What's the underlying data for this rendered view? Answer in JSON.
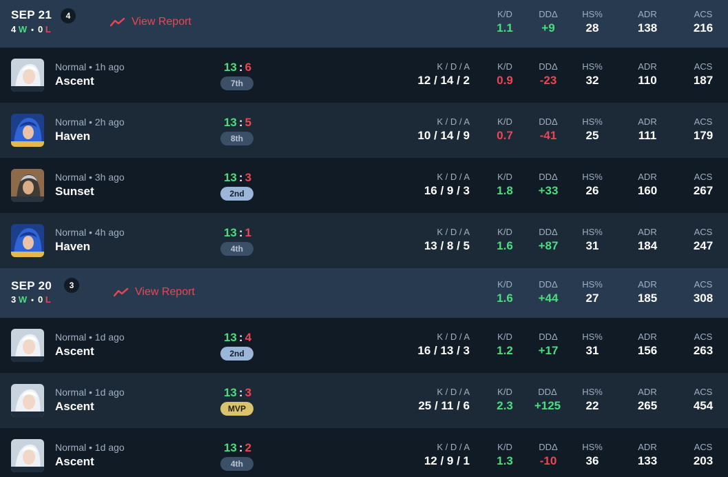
{
  "days": [
    {
      "date": "SEP 21",
      "count": "4",
      "wins": "4",
      "win_suffix": "W",
      "losses": "0",
      "loss_suffix": "L",
      "view_report": "View Report",
      "summary": {
        "kd_label": "K/D",
        "kd": "1.1",
        "dd_label": "DDΔ",
        "dd": "+9",
        "hs_label": "HS%",
        "hs": "28",
        "adr_label": "ADR",
        "adr": "138",
        "acs_label": "ACS",
        "acs": "216"
      },
      "matches": [
        {
          "mode": "Normal • 1h ago",
          "map": "Ascent",
          "score_won": "13",
          "score_lost": "6",
          "placement": "7th",
          "kda_label": "K / D / A",
          "kda": "12 / 14 / 2",
          "kd_label": "K/D",
          "kd": "0.9",
          "dd_label": "DDΔ",
          "dd": "-23",
          "hs_label": "HS%",
          "hs": "32",
          "adr_label": "ADR",
          "adr": "110",
          "acs_label": "ACS",
          "acs": "187"
        },
        {
          "mode": "Normal • 2h ago",
          "map": "Haven",
          "score_won": "13",
          "score_lost": "5",
          "placement": "8th",
          "kda_label": "K / D / A",
          "kda": "10 / 14 / 9",
          "kd_label": "K/D",
          "kd": "0.7",
          "dd_label": "DDΔ",
          "dd": "-41",
          "hs_label": "HS%",
          "hs": "25",
          "adr_label": "ADR",
          "adr": "111",
          "acs_label": "ACS",
          "acs": "179"
        },
        {
          "mode": "Normal • 3h ago",
          "map": "Sunset",
          "score_won": "13",
          "score_lost": "3",
          "placement": "2nd",
          "kda_label": "K / D / A",
          "kda": "16 / 9 / 3",
          "kd_label": "K/D",
          "kd": "1.8",
          "dd_label": "DDΔ",
          "dd": "+33",
          "hs_label": "HS%",
          "hs": "26",
          "adr_label": "ADR",
          "adr": "160",
          "acs_label": "ACS",
          "acs": "267"
        },
        {
          "mode": "Normal • 4h ago",
          "map": "Haven",
          "score_won": "13",
          "score_lost": "1",
          "placement": "4th",
          "kda_label": "K / D / A",
          "kda": "13 / 8 / 5",
          "kd_label": "K/D",
          "kd": "1.6",
          "dd_label": "DDΔ",
          "dd": "+87",
          "hs_label": "HS%",
          "hs": "31",
          "adr_label": "ADR",
          "adr": "184",
          "acs_label": "ACS",
          "acs": "247"
        }
      ]
    },
    {
      "date": "SEP 20",
      "count": "3",
      "wins": "3",
      "win_suffix": "W",
      "losses": "0",
      "loss_suffix": "L",
      "view_report": "View Report",
      "summary": {
        "kd_label": "K/D",
        "kd": "1.6",
        "dd_label": "DDΔ",
        "dd": "+44",
        "hs_label": "HS%",
        "hs": "27",
        "adr_label": "ADR",
        "adr": "185",
        "acs_label": "ACS",
        "acs": "308"
      },
      "matches": [
        {
          "mode": "Normal • 1d ago",
          "map": "Ascent",
          "score_won": "13",
          "score_lost": "4",
          "placement": "2nd",
          "kda_label": "K / D / A",
          "kda": "16 / 13 / 3",
          "kd_label": "K/D",
          "kd": "1.2",
          "dd_label": "DDΔ",
          "dd": "+17",
          "hs_label": "HS%",
          "hs": "31",
          "adr_label": "ADR",
          "adr": "156",
          "acs_label": "ACS",
          "acs": "263"
        },
        {
          "mode": "Normal • 1d ago",
          "map": "Ascent",
          "score_won": "13",
          "score_lost": "3",
          "placement": "MVP",
          "kda_label": "K / D / A",
          "kda": "25 / 11 / 6",
          "kd_label": "K/D",
          "kd": "2.3",
          "dd_label": "DDΔ",
          "dd": "+125",
          "hs_label": "HS%",
          "hs": "22",
          "adr_label": "ADR",
          "adr": "265",
          "acs_label": "ACS",
          "acs": "454"
        },
        {
          "mode": "Normal • 1d ago",
          "map": "Ascent",
          "score_won": "13",
          "score_lost": "2",
          "placement": "4th",
          "kda_label": "K / D / A",
          "kda": "12 / 9 / 1",
          "kd_label": "K/D",
          "kd": "1.3",
          "dd_label": "DDΔ",
          "dd": "-10",
          "hs_label": "HS%",
          "hs": "36",
          "adr_label": "ADR",
          "adr": "133",
          "acs_label": "ACS",
          "acs": "203"
        }
      ]
    }
  ],
  "colors": {
    "positive": "#4ade80",
    "negative": "#ef4454",
    "header_bg": "#283a4f",
    "row_dark": "#111b26",
    "row_light": "#1c2a38"
  },
  "icons": {
    "view_report": "trend-line-icon",
    "agent_ascent": "agent-portrait-icon",
    "agent_haven": "agent-portrait-icon",
    "agent_sunset": "agent-portrait-icon"
  }
}
